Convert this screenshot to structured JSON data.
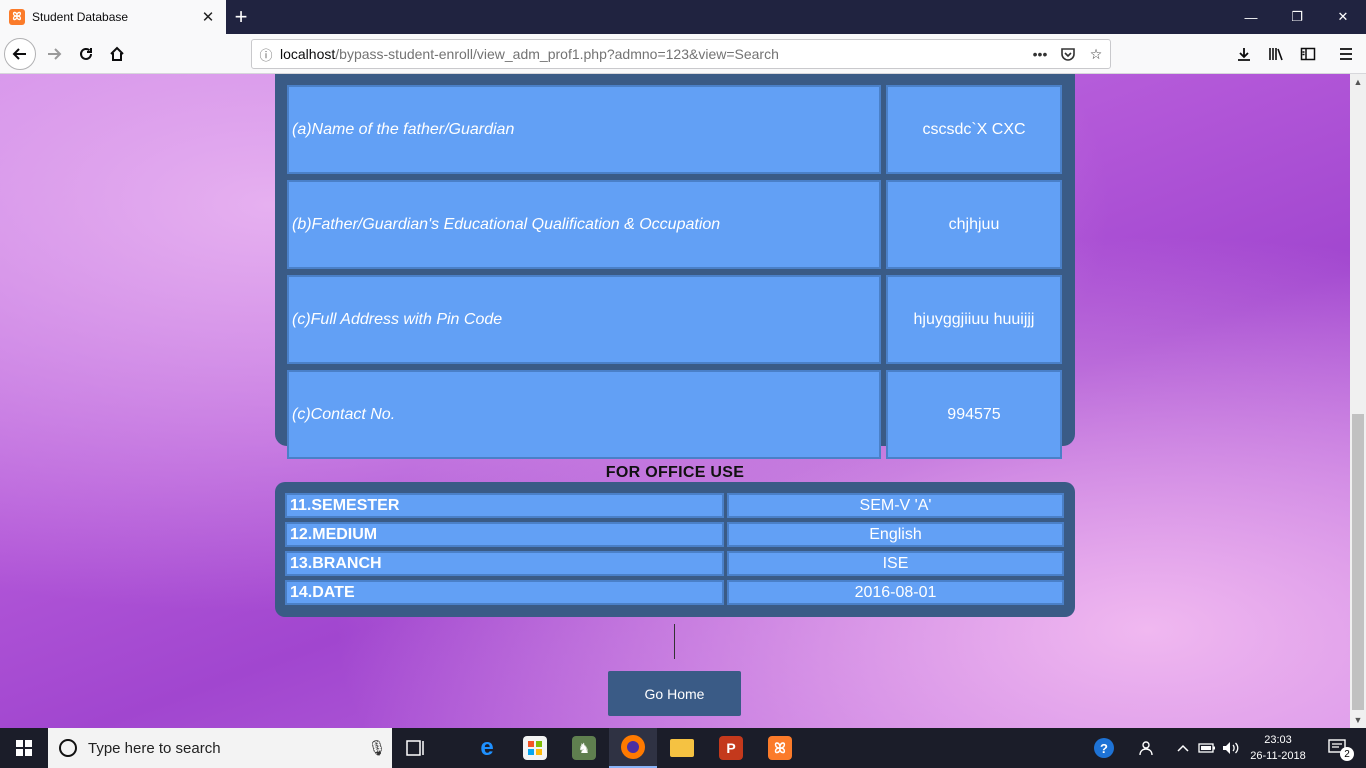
{
  "browser": {
    "tab_title": "Student Database",
    "tab_close": "✕",
    "new_tab": "+",
    "url_host": "localhost",
    "url_path": "/bypass-student-enroll/view_adm_prof1.php?admno=123&view=Search",
    "window_minimize": "—",
    "window_restore": "❐",
    "window_close": "✕"
  },
  "guardian_rows": [
    {
      "label": "(a)Name of the father/Guardian",
      "value": "cscsdc`X CXC"
    },
    {
      "label": "(b)Father/Guardian's Educational Qualification & Occupation",
      "value": "chjhjuu"
    },
    {
      "label": "(c)Full Address with Pin Code",
      "value": "hjuyggjiiuu huuijjj"
    },
    {
      "label": "(c)Contact No.",
      "value": "994575"
    }
  ],
  "office": {
    "title": "FOR OFFICE USE",
    "rows": [
      {
        "label": "11.SEMESTER",
        "value": "SEM-V  'A'"
      },
      {
        "label": "12.MEDIUM",
        "value": "English"
      },
      {
        "label": "13.BRANCH",
        "value": "ISE"
      },
      {
        "label": "14.DATE",
        "value": "2016-08-01"
      }
    ]
  },
  "buttons": {
    "go_home": "Go Home"
  },
  "taskbar": {
    "search_placeholder": "Type here to search",
    "time": "23:03",
    "date": "26-11-2018",
    "notification_count": "2"
  },
  "colors": {
    "panel": "#3a5b86",
    "cell": "#62a0f5",
    "cell_border": "#4a80c8"
  },
  "icons": {
    "back": "arrow-left-icon",
    "forward": "arrow-right-icon",
    "reload": "reload-icon",
    "home": "home-icon",
    "site_info": "info-icon",
    "page_actions": "more-icon",
    "pocket": "pocket-icon",
    "bookmark": "star-icon",
    "downloads": "download-icon",
    "library": "library-icon",
    "sidebar": "sidebar-icon",
    "menu": "hamburger-icon"
  }
}
